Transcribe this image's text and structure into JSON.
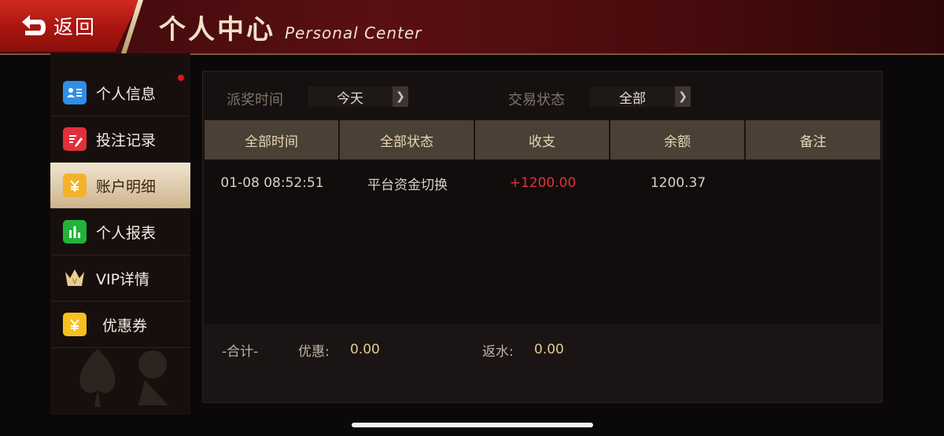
{
  "header": {
    "back_label": "返回",
    "title_cn": "个人中心",
    "title_en": "Personal Center"
  },
  "sidebar": {
    "items": [
      {
        "label": "个人信息",
        "icon": "id-card-icon",
        "color": "#2f8ee6",
        "badge": true
      },
      {
        "label": "投注记录",
        "icon": "document-edit-icon",
        "color": "#e2303a",
        "badge": false
      },
      {
        "label": "账户明细",
        "icon": "yuan-wallet-icon",
        "color": "#f2b32a",
        "badge": false,
        "active": true
      },
      {
        "label": "个人报表",
        "icon": "bar-chart-icon",
        "color": "#21b33a",
        "badge": false
      },
      {
        "label": "VIP详情",
        "icon": "crown-icon",
        "color": "#e8cf8c",
        "badge": false
      },
      {
        "label": "优惠券",
        "icon": "coupon-icon",
        "color": "#f4c21e",
        "badge": false
      }
    ]
  },
  "filters": {
    "prize_time_label": "派奖时间",
    "prize_time_value": "今天",
    "tx_status_label": "交易状态",
    "tx_status_value": "全部"
  },
  "table": {
    "columns": [
      "全部时间",
      "全部状态",
      "收支",
      "余额",
      "备注"
    ],
    "rows": [
      {
        "time": "01-08 08:52:51",
        "status": "平台资金切换",
        "amount": "+1200.00",
        "balance": "1200.37",
        "note": ""
      }
    ]
  },
  "summary": {
    "total_label": "-合计-",
    "discount_label": "优惠:",
    "discount_value": "0.00",
    "rebate_label": "返水:",
    "rebate_value": "0.00"
  },
  "colors": {
    "header_bg": "#4a0c0e",
    "back_button": "#c0201a",
    "accent_gold": "#e7c98a",
    "positive_amount": "#e0323a"
  }
}
